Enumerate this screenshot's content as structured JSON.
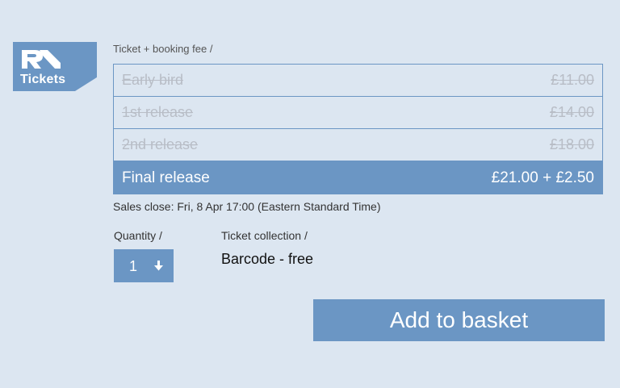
{
  "logo": {
    "text": "Tickets",
    "icon": "ra-logo-icon"
  },
  "fee_label": "Ticket + booking fee /",
  "tiers": [
    {
      "name": "Early bird",
      "price": "£11.00",
      "status": "sold-out"
    },
    {
      "name": "1st release",
      "price": "£14.00",
      "status": "sold-out"
    },
    {
      "name": "2nd release",
      "price": "£18.00",
      "status": "sold-out"
    },
    {
      "name": "Final release",
      "price": "£21.00 + £2.50",
      "status": "available"
    }
  ],
  "sales_close": "Sales close: Fri, 8 Apr 17:00 (Eastern Standard Time)",
  "quantity": {
    "label": "Quantity /",
    "value": "1",
    "icon": "arrow-down-icon"
  },
  "collection": {
    "label": "Ticket collection /",
    "value": "Barcode - free"
  },
  "add_button": {
    "label": "Add to basket"
  },
  "colors": {
    "accent": "#6b96c4",
    "background": "#dce6f1",
    "struck_text": "#b8bdc6"
  }
}
